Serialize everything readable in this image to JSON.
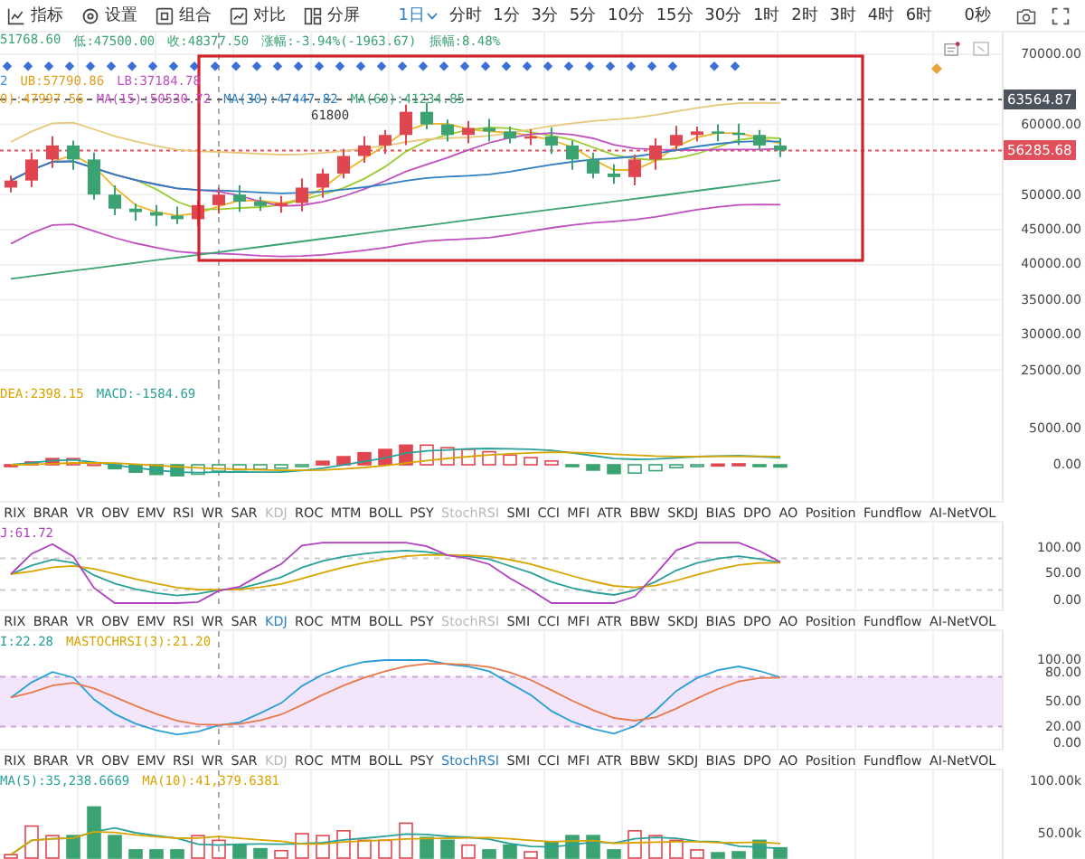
{
  "toolbar": {
    "tools": [
      {
        "label": "指标",
        "kind": "indicator"
      },
      {
        "label": "设置",
        "kind": "settings"
      },
      {
        "label": "组合",
        "kind": "combine"
      },
      {
        "label": "对比",
        "kind": "compare"
      },
      {
        "label": "分屏",
        "kind": "split"
      }
    ],
    "intervals": [
      {
        "label": "1日",
        "selected": true
      },
      {
        "label": "分时",
        "selected": false
      },
      {
        "label": "1分",
        "selected": false
      },
      {
        "label": "3分",
        "selected": false
      },
      {
        "label": "5分",
        "selected": false
      },
      {
        "label": "10分",
        "selected": false
      },
      {
        "label": "15分",
        "selected": false
      },
      {
        "label": "30分",
        "selected": false
      },
      {
        "label": "1时",
        "selected": false
      },
      {
        "label": "2时",
        "selected": false
      },
      {
        "label": "3时",
        "selected": false
      },
      {
        "label": "4时",
        "selected": false
      },
      {
        "label": "6时",
        "selected": false
      }
    ],
    "refresh": "0秒"
  },
  "main_chart": {
    "info": [
      {
        "text": "51768.60",
        "color": "#3aa371"
      },
      {
        "text": "低:47500.00",
        "color": "#3aa371"
      },
      {
        "text": "收:48377.50",
        "color": "#3aa371"
      },
      {
        "text": "涨幅:-3.94%(-1963.67)",
        "color": "#3aa371"
      },
      {
        "text": "振幅:8.48%",
        "color": "#3aa371"
      }
    ],
    "legend": [
      [
        {
          "text": "2",
          "color": "#3a8fd6"
        },
        {
          "text": "UB:57790.86",
          "color": "#e0a020"
        },
        {
          "text": "LB:37184.78",
          "color": "#c04fc0"
        }
      ],
      [
        {
          "text": "0):47997.56",
          "color": "#e0a020"
        },
        {
          "text": "MA(15):50530.72",
          "color": "#c04fc0"
        },
        {
          "text": "MA(30):47447.82",
          "color": "#2f7fc1"
        },
        {
          "text": "MA(60):41234.85",
          "color": "#3aa371"
        }
      ]
    ],
    "peak_label": "61800",
    "axis": [
      "70000.00",
      "60000.00",
      "50000.00",
      "45000.00",
      "40000.00",
      "35000.00",
      "30000.00",
      "25000.00"
    ],
    "price_tags": [
      {
        "value": "63564.87",
        "color": "#4d535c"
      },
      {
        "value": "56285.68",
        "color": "#e0505a"
      }
    ]
  },
  "sub_panes": [
    {
      "kind": "macd",
      "legend": [
        {
          "text": "DEA:2398.15",
          "color": "#d9a400"
        },
        {
          "text": "MACD:-1584.69",
          "color": "#2aa198"
        }
      ],
      "axis": [
        "5000.00",
        "0.00"
      ],
      "tabs": [
        {
          "label": "RIX",
          "selected": false,
          "disabled": false
        },
        {
          "label": "BRAR",
          "selected": false,
          "disabled": false
        },
        {
          "label": "VR",
          "selected": false,
          "disabled": false
        },
        {
          "label": "OBV",
          "selected": false,
          "disabled": false
        },
        {
          "label": "EMV",
          "selected": false,
          "disabled": false
        },
        {
          "label": "RSI",
          "selected": false,
          "disabled": false
        },
        {
          "label": "WR",
          "selected": false,
          "disabled": false
        },
        {
          "label": "SAR",
          "selected": false,
          "disabled": false
        },
        {
          "label": "KDJ",
          "selected": false,
          "disabled": true
        },
        {
          "label": "ROC",
          "selected": false,
          "disabled": false
        },
        {
          "label": "MTM",
          "selected": false,
          "disabled": false
        },
        {
          "label": "BOLL",
          "selected": false,
          "disabled": false
        },
        {
          "label": "PSY",
          "selected": false,
          "disabled": false
        },
        {
          "label": "StochRSI",
          "selected": false,
          "disabled": true
        },
        {
          "label": "SMI",
          "selected": false,
          "disabled": false
        },
        {
          "label": "CCI",
          "selected": false,
          "disabled": false
        },
        {
          "label": "MFI",
          "selected": false,
          "disabled": false
        },
        {
          "label": "ATR",
          "selected": false,
          "disabled": false
        },
        {
          "label": "BBW",
          "selected": false,
          "disabled": false
        },
        {
          "label": "SKDJ",
          "selected": false,
          "disabled": false
        },
        {
          "label": "BIAS",
          "selected": false,
          "disabled": false
        },
        {
          "label": "DPO",
          "selected": false,
          "disabled": false
        },
        {
          "label": "AO",
          "selected": false,
          "disabled": false
        },
        {
          "label": "Position",
          "selected": false,
          "disabled": false
        },
        {
          "label": "Fundflow",
          "selected": false,
          "disabled": false
        },
        {
          "label": "AI-NetVOL",
          "selected": false,
          "disabled": false
        }
      ]
    },
    {
      "kind": "kdj",
      "legend": [
        {
          "text": "J:61.72",
          "color": "#b040c0"
        }
      ],
      "axis": [
        "100.00",
        "50.00",
        "0.00"
      ],
      "tabs": [
        {
          "label": "RIX",
          "selected": false,
          "disabled": false
        },
        {
          "label": "BRAR",
          "selected": false,
          "disabled": false
        },
        {
          "label": "VR",
          "selected": false,
          "disabled": false
        },
        {
          "label": "OBV",
          "selected": false,
          "disabled": false
        },
        {
          "label": "EMV",
          "selected": false,
          "disabled": false
        },
        {
          "label": "RSI",
          "selected": false,
          "disabled": false
        },
        {
          "label": "WR",
          "selected": false,
          "disabled": false
        },
        {
          "label": "SAR",
          "selected": false,
          "disabled": false
        },
        {
          "label": "KDJ",
          "selected": true,
          "disabled": false
        },
        {
          "label": "ROC",
          "selected": false,
          "disabled": false
        },
        {
          "label": "MTM",
          "selected": false,
          "disabled": false
        },
        {
          "label": "BOLL",
          "selected": false,
          "disabled": false
        },
        {
          "label": "PSY",
          "selected": false,
          "disabled": false
        },
        {
          "label": "StochRSI",
          "selected": false,
          "disabled": true
        },
        {
          "label": "SMI",
          "selected": false,
          "disabled": false
        },
        {
          "label": "CCI",
          "selected": false,
          "disabled": false
        },
        {
          "label": "MFI",
          "selected": false,
          "disabled": false
        },
        {
          "label": "ATR",
          "selected": false,
          "disabled": false
        },
        {
          "label": "BBW",
          "selected": false,
          "disabled": false
        },
        {
          "label": "SKDJ",
          "selected": false,
          "disabled": false
        },
        {
          "label": "BIAS",
          "selected": false,
          "disabled": false
        },
        {
          "label": "DPO",
          "selected": false,
          "disabled": false
        },
        {
          "label": "AO",
          "selected": false,
          "disabled": false
        },
        {
          "label": "Position",
          "selected": false,
          "disabled": false
        },
        {
          "label": "Fundflow",
          "selected": false,
          "disabled": false
        },
        {
          "label": "AI-NetVOL",
          "selected": false,
          "disabled": false
        }
      ]
    },
    {
      "kind": "stochrsi",
      "legend": [
        {
          "text": "I:22.28",
          "color": "#2aa198"
        },
        {
          "text": "MASTOCHRSI(3):21.20",
          "color": "#d9a400"
        }
      ],
      "axis": [
        "100.00",
        "80.00",
        "50.00",
        "20.00",
        "0.00"
      ],
      "tabs": [
        {
          "label": "RIX",
          "selected": false,
          "disabled": false
        },
        {
          "label": "BRAR",
          "selected": false,
          "disabled": false
        },
        {
          "label": "VR",
          "selected": false,
          "disabled": false
        },
        {
          "label": "OBV",
          "selected": false,
          "disabled": false
        },
        {
          "label": "EMV",
          "selected": false,
          "disabled": false
        },
        {
          "label": "RSI",
          "selected": false,
          "disabled": false
        },
        {
          "label": "WR",
          "selected": false,
          "disabled": false
        },
        {
          "label": "SAR",
          "selected": false,
          "disabled": false
        },
        {
          "label": "KDJ",
          "selected": false,
          "disabled": true
        },
        {
          "label": "ROC",
          "selected": false,
          "disabled": false
        },
        {
          "label": "MTM",
          "selected": false,
          "disabled": false
        },
        {
          "label": "BOLL",
          "selected": false,
          "disabled": false
        },
        {
          "label": "PSY",
          "selected": false,
          "disabled": false
        },
        {
          "label": "StochRSI",
          "selected": true,
          "disabled": false
        },
        {
          "label": "SMI",
          "selected": false,
          "disabled": false
        },
        {
          "label": "CCI",
          "selected": false,
          "disabled": false
        },
        {
          "label": "MFI",
          "selected": false,
          "disabled": false
        },
        {
          "label": "ATR",
          "selected": false,
          "disabled": false
        },
        {
          "label": "BBW",
          "selected": false,
          "disabled": false
        },
        {
          "label": "SKDJ",
          "selected": false,
          "disabled": false
        },
        {
          "label": "BIAS",
          "selected": false,
          "disabled": false
        },
        {
          "label": "DPO",
          "selected": false,
          "disabled": false
        },
        {
          "label": "AO",
          "selected": false,
          "disabled": false
        },
        {
          "label": "Position",
          "selected": false,
          "disabled": false
        },
        {
          "label": "Fundflow",
          "selected": false,
          "disabled": false
        },
        {
          "label": "AI-NetVOL",
          "selected": false,
          "disabled": false
        }
      ]
    }
  ],
  "volume_pane": {
    "legend": [
      {
        "text": "MA(5):35,238.6669",
        "color": "#2aa198"
      },
      {
        "text": "MA(10):41,379.6381",
        "color": "#d9a400"
      }
    ],
    "axis": [
      "100.00k",
      "50.00k"
    ]
  }
}
